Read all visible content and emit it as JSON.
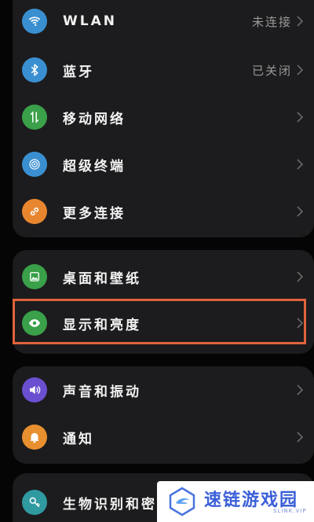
{
  "settings": {
    "items": [
      {
        "label": "WLAN",
        "value": "未连接",
        "icon": "wifi-icon",
        "color": "#3a8fd0"
      },
      {
        "label": "蓝牙",
        "value": "已关闭",
        "icon": "bluetooth-icon",
        "color": "#3a8fd0"
      },
      {
        "label": "移动网络",
        "value": "",
        "icon": "mobile-data-icon",
        "color": "#3aa049"
      },
      {
        "label": "超级终端",
        "value": "",
        "icon": "super-device-icon",
        "color": "#3a8fd0"
      },
      {
        "label": "更多连接",
        "value": "",
        "icon": "link-icon",
        "color": "#e8862f"
      },
      {
        "label": "桌面和壁纸",
        "value": "",
        "icon": "wallpaper-icon",
        "color": "#3aa049"
      },
      {
        "label": "显示和亮度",
        "value": "",
        "icon": "eye-icon",
        "color": "#3aa049"
      },
      {
        "label": "声音和振动",
        "value": "",
        "icon": "volume-icon",
        "color": "#6a4fd0"
      },
      {
        "label": "通知",
        "value": "",
        "icon": "bell-icon",
        "color": "#e8902f"
      },
      {
        "label": "生物识别和密",
        "value": "",
        "icon": "key-icon",
        "color": "#2f9aa0"
      }
    ]
  },
  "highlight_color": "#e0633b",
  "watermark": {
    "text": "速链游戏园",
    "sub": "SLINK.VIP"
  }
}
